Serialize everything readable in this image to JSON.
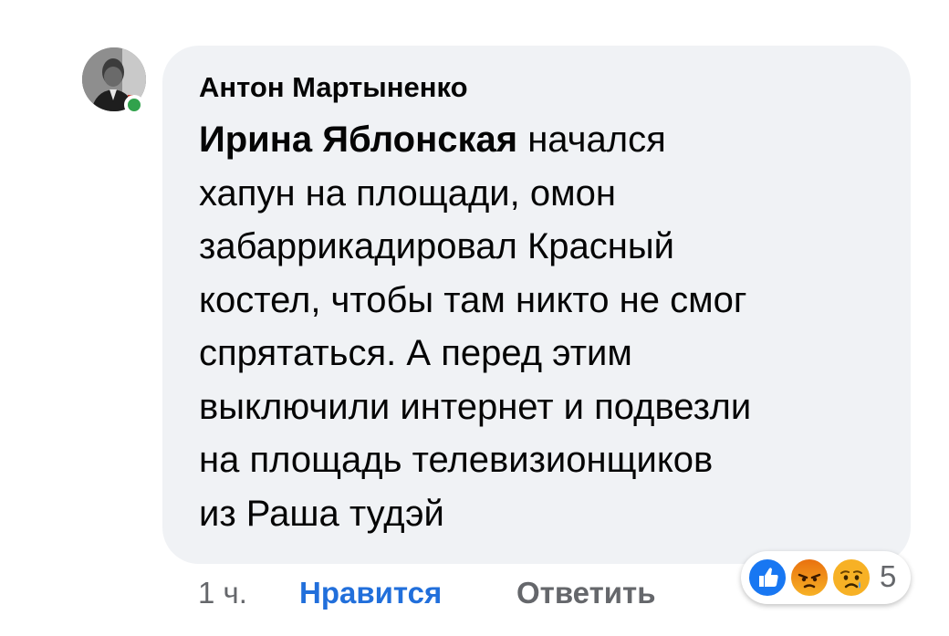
{
  "comment": {
    "author": "Антон Мартыненко",
    "mention": "Ирина Яблонская",
    "lines": [
      " начался",
      "хапун на площади, омон",
      "забаррикадировал Красный",
      "костел, чтобы там никто не смог",
      "спрятаться. А перед этим",
      "выключили интернет и подвезли",
      "на площадь телевизионщиков",
      "из Раша тудэй"
    ]
  },
  "actions": {
    "time": "1 ч.",
    "like_label": "Нравится",
    "reply_label": "Ответить"
  },
  "reactions": {
    "icons": [
      "like-icon",
      "angry-icon",
      "sad-icon"
    ],
    "count": "5"
  },
  "colors": {
    "bubble": "#f0f2f5",
    "link_blue": "#216fdb",
    "muted": "#65676b",
    "online": "#31a24c"
  }
}
